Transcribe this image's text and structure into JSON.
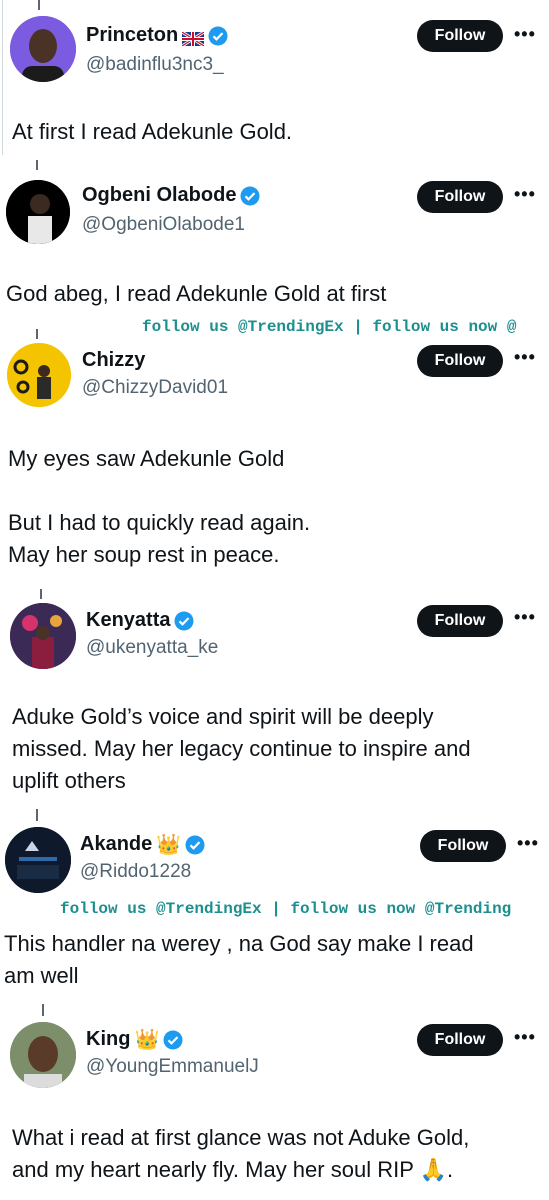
{
  "follow_label": "Follow",
  "more_label": "•••",
  "watermark": {
    "line1": "follow us @TrendingEx | follow us now @",
    "line2": "follow us @TrendingEx | follow us now @Trending"
  },
  "colors": {
    "verified": "#1d9bf0",
    "follow_bg": "#0f1419",
    "watermark": "#1d8f8f"
  },
  "tweets": [
    {
      "name": "Princeton",
      "handle": "@badinflu3nc3_",
      "badge": "uk-flag-icon",
      "text": "At first I read Adekunle Gold."
    },
    {
      "name": "Ogbeni Olabode",
      "handle": "@OgbeniOlabode1",
      "badge": "",
      "text": "God abeg, I read Adekunle Gold at first"
    },
    {
      "name": "Chizzy",
      "handle": "@ChizzyDavid01",
      "badge": "",
      "text": "My eyes saw Adekunle Gold\n\nBut I had to quickly read again.\nMay her soup rest in peace."
    },
    {
      "name": "Kenyatta",
      "handle": "@ukenyatta_ke",
      "badge": "",
      "text": "Aduke Gold’s voice and spirit will be deeply\nmissed. May her legacy continue to inspire and\nuplift others"
    },
    {
      "name": "Akande",
      "handle": "@Riddo1228",
      "badge": "crown-icon",
      "text": "This handler na werey , na God say make I read\nam well"
    },
    {
      "name": "King",
      "handle": "@YoungEmmanuelJ",
      "badge": "crown-icon",
      "text": "What i read at first glance was not Aduke Gold,\nand my heart nearly fly.  May her soul RIP 🙏."
    }
  ]
}
